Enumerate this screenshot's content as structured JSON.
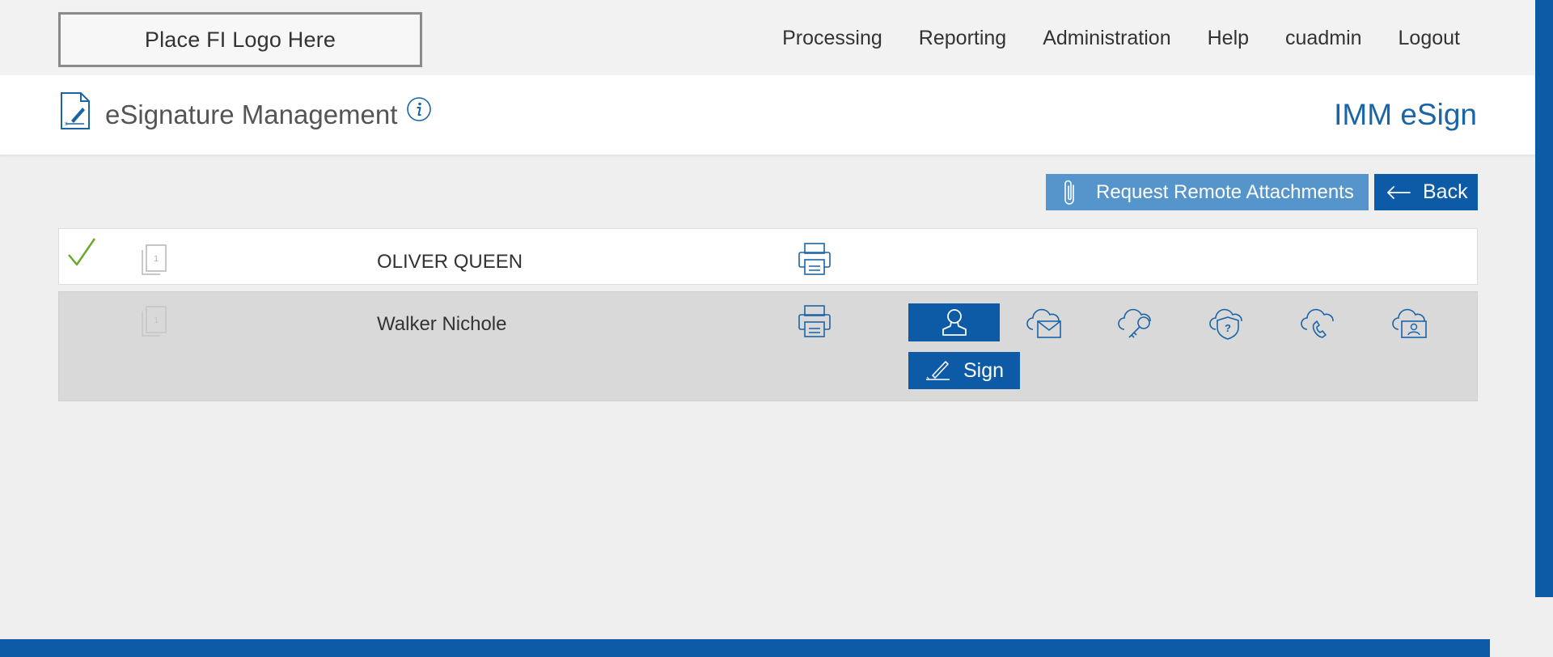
{
  "header": {
    "logo_text": "Place FI Logo Here",
    "nav": [
      "Processing",
      "Reporting",
      "Administration",
      "Help",
      "cuadmin",
      "Logout"
    ]
  },
  "titlebar": {
    "title": "eSignature Management",
    "app_name": "IMM eSign"
  },
  "actions": {
    "request_attachments": "Request Remote Attachments",
    "back": "Back"
  },
  "signers": [
    {
      "name": "OLIVER QUEEN",
      "status": "signed",
      "doc_count": "1"
    },
    {
      "name": "Walker Nichole",
      "status": "pending",
      "doc_count": "1",
      "sign_label": "Sign"
    }
  ],
  "auth_methods": [
    "person-icon",
    "cloud-email-icon",
    "cloud-key-icon",
    "cloud-security-question-icon",
    "cloud-phone-icon",
    "cloud-id-icon"
  ],
  "colors": {
    "primary": "#0d5aa7",
    "secondary": "#5595cc",
    "check": "#6aaa2a"
  }
}
